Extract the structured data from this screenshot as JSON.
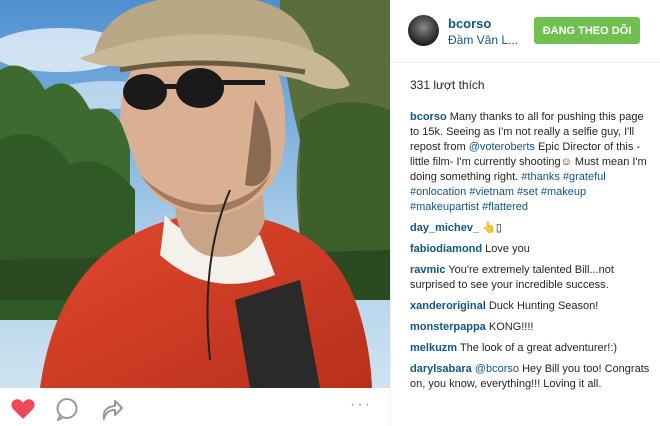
{
  "post": {
    "username": "bcorso",
    "location": "Đầm Vân L...",
    "follow_label": "ĐANG THEO DÕI",
    "likes": "331 lượt thích"
  },
  "caption": {
    "user": "bcorso",
    "t1": "Many thanks to all for pushing this page to 15k. Seeing as I'm not really a selfie guy, I'll repost from",
    "mention": "@voteroberts",
    "t2": "Epic Director of this -little film- I'm currently shooting☺ Must mean I'm doing something right.",
    "hashtags": [
      "#thanks",
      "#grateful",
      "#onlocation",
      "#vietnam",
      "#set",
      "#makeup",
      "#makeupartist",
      "#flattered"
    ]
  },
  "comments": [
    {
      "user": "day_michev_",
      "text": "👆▯"
    },
    {
      "user": "fabiodiamond",
      "text": "Love you"
    },
    {
      "user": "ravmic",
      "text": "You're extremely talented Bill...not surprised to see your incredible success."
    },
    {
      "user": "xanderoriginal",
      "text": "Duck Hunting Season!"
    },
    {
      "user": "monsterpappa",
      "text": "KONG!!!!"
    },
    {
      "user": "melkuzm",
      "text": "The look of a great adventurer!:)"
    },
    {
      "user": "darylsabara",
      "mention": "@bcorso",
      "text": "Hey Bill you too! Congrats on, you know, everything!!! Loving it all."
    }
  ],
  "actions": {
    "more_label": "···"
  },
  "icons": {
    "like": "heart-icon",
    "comment": "comment-icon",
    "share": "share-icon"
  },
  "colors": {
    "link": "#125688",
    "follow": "#70c050",
    "heart": "#ed4956"
  }
}
